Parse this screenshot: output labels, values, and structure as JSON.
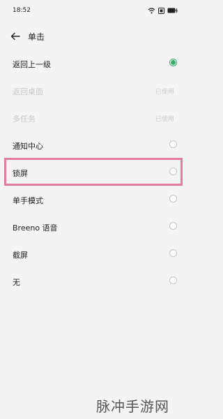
{
  "status_bar": {
    "time": "18:52",
    "icons": [
      "wifi-icon",
      "sim-icon",
      "battery-charging-icon"
    ]
  },
  "header": {
    "back_icon": "arrow-left-icon",
    "title": "单击"
  },
  "options": [
    {
      "label": "返回上一级",
      "status": "",
      "selected": true,
      "disabled": false
    },
    {
      "label": "返回桌面",
      "status": "已使用",
      "selected": false,
      "disabled": true
    },
    {
      "label": "多任务",
      "status": "已使用",
      "selected": false,
      "disabled": true
    },
    {
      "label": "通知中心",
      "status": "",
      "selected": false,
      "disabled": false
    },
    {
      "label": "锁屏",
      "status": "",
      "selected": false,
      "disabled": false
    },
    {
      "label": "单手模式",
      "status": "",
      "selected": false,
      "disabled": false
    },
    {
      "label": "Breeno 语音",
      "status": "",
      "selected": false,
      "disabled": false
    },
    {
      "label": "截屏",
      "status": "",
      "selected": false,
      "disabled": false
    },
    {
      "label": "无",
      "status": "",
      "selected": false,
      "disabled": false
    }
  ],
  "colors": {
    "accent": "#2fb36a",
    "highlight": "#e07da0",
    "background": "#f4f4f4"
  },
  "watermark": "脉冲手游网"
}
